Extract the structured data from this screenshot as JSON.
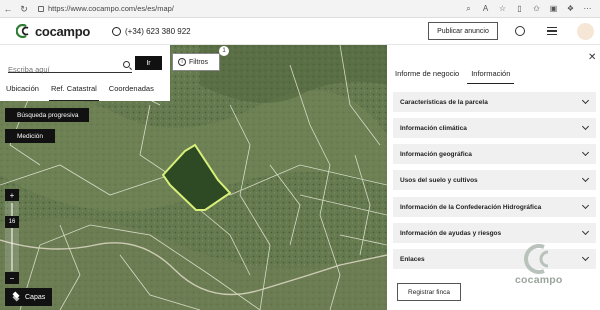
{
  "browser": {
    "url": "https://www.cocampo.com/es/es/map/"
  },
  "header": {
    "logo_text": "cocampo",
    "phone": "(+34) 623 380 922",
    "publish_label": "Publicar anuncio"
  },
  "search": {
    "placeholder": "Escriba aquí",
    "go_label": "Ir",
    "tabs": [
      "Ubicación",
      "Ref. Catastral",
      "Coordenadas"
    ],
    "active_tab": "Ref. Catastral"
  },
  "map_controls": {
    "filters_label": "Filtros",
    "filters_count": "1",
    "progressive_search": "Búsqueda progresiva",
    "measure": "Medición",
    "zoom_in": "+",
    "zoom_level": "16",
    "zoom_out": "−",
    "layers": "Capas"
  },
  "side_panel": {
    "tabs": [
      "Informe de negocio",
      "Información"
    ],
    "active_tab": "Información",
    "sections": [
      "Características de la parcela",
      "Información climática",
      "Información geográfica",
      "Usos del suelo y cultivos",
      "Información de la Confederación Hidrográfica",
      "Información de ayudas y riesgos",
      "Enlaces"
    ],
    "register_label": "Registrar finca",
    "watermark": "cocampo"
  },
  "colors": {
    "accent_dark": "#111111",
    "parcel_highlight": "#d8f07a",
    "section_bg": "#f0f0f0"
  }
}
